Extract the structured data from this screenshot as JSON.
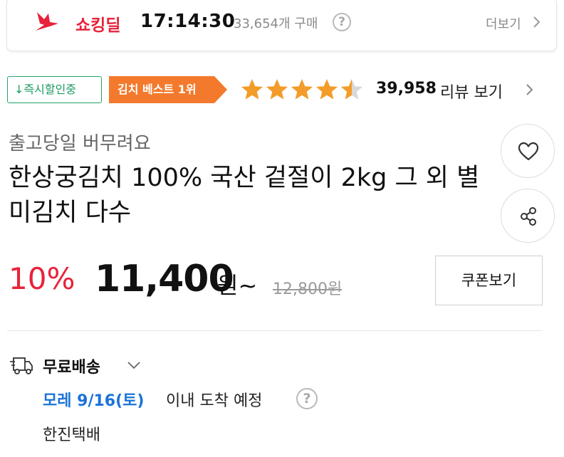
{
  "deal": {
    "name": "쇼킹딜",
    "timer": "17:14:30",
    "purchase_count": "33,654개 구매",
    "help": "?",
    "more_label": "더보기"
  },
  "badges": {
    "instant_discount": "↓즉시할인중",
    "best": "김치 베스트 1위"
  },
  "rating": {
    "stars": 4.5,
    "review_count": "39,958",
    "review_link": "리뷰 보기"
  },
  "product": {
    "pre_title": "출고당일 버무려요",
    "title": "한상궁김치 100% 국산 겉절이 2kg 그 외 별미김치 다수"
  },
  "price": {
    "discount_rate": "10%",
    "sale_price": "11,400",
    "unit_suffix": "원~",
    "original_price": "12,800원",
    "coupon_button": "쿠폰보기"
  },
  "shipping": {
    "label": "무료배송",
    "arrival_date": "모레 9/16(토)",
    "arrival_text": "이내 도착 예정",
    "help": "?",
    "courier": "한진택배"
  },
  "colors": {
    "accent_red": "#e8223a",
    "best_orange": "#f37a2c",
    "instant_green": "#1a9a60",
    "star_orange": "#f39c2a",
    "date_blue": "#1a73d9"
  }
}
